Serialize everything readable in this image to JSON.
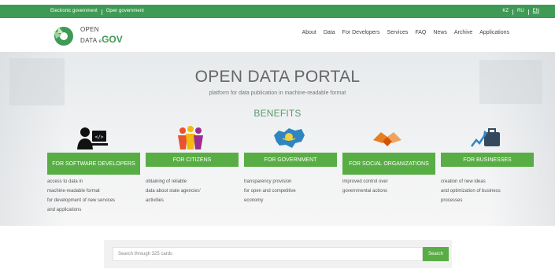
{
  "topbar": {
    "links": [
      "Electronic government",
      "Open government"
    ],
    "languages": [
      "KZ",
      "RU",
      "EN"
    ],
    "active_language": "EN",
    "color": "#3f9a55"
  },
  "header": {
    "logo_line1": "OPEN",
    "logo_line2": "DATA",
    "logo_e": "e",
    "logo_gov": "GOV",
    "nav": [
      "About",
      "Data",
      "For Developers",
      "Services",
      "FAQ",
      "News",
      "Archive",
      "Applications"
    ]
  },
  "hero": {
    "title": "OPEN DATA PORTAL",
    "subtitle": "platform for data publication in machine-readable format",
    "benefits_heading": "BENEFITS",
    "accent": "#59ad45",
    "cards": [
      {
        "icon": "developer-icon",
        "label": "FOR SOFTWARE DEVELOPERS",
        "desc": [
          "access to data in",
          "machine-readable format",
          "for development of new services",
          "and applications"
        ]
      },
      {
        "icon": "citizens-icon",
        "label": "FOR CITIZENS",
        "desc": [
          "obtaining of reliable",
          "data about state agencies'",
          "activities"
        ]
      },
      {
        "icon": "kazakhstan-map-icon",
        "label": "FOR GOVERNMENT",
        "desc": [
          "transparency provision",
          "for open and competitive",
          "economy"
        ]
      },
      {
        "icon": "handshake-icon",
        "label": "FOR SOCIAL ORGANIZATIONS",
        "desc": [
          "improved control over",
          "governmental actions"
        ]
      },
      {
        "icon": "business-icon",
        "label": "FOR BUSINESSES",
        "desc": [
          "creation of new ideas",
          "and optimization of business",
          "processes"
        ]
      }
    ]
  },
  "search": {
    "placeholder": "Search through 325 cards",
    "button_label": "Search"
  }
}
